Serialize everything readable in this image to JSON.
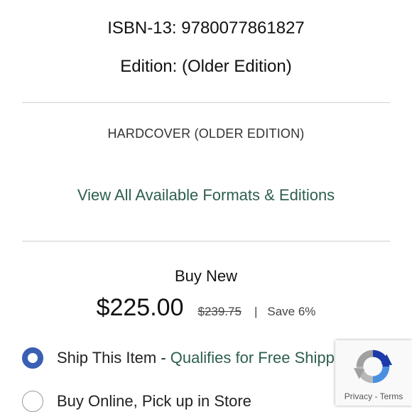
{
  "product": {
    "isbn_line": "ISBN-13: 9780077861827",
    "edition_line": "Edition: (Older Edition)",
    "format_label": "HARDCOVER (OLDER EDITION)",
    "formats_link": "View All Available Formats & Editions"
  },
  "pricing": {
    "heading": "Buy New",
    "price": "$225.00",
    "original_price": "$239.75",
    "separator": "|",
    "savings": "Save 6%"
  },
  "fulfillment": {
    "ship": {
      "label": "Ship This Item - ",
      "qualifier": "Qualifies for Free Shipping",
      "selected": true
    },
    "pickup": {
      "label": "Buy Online, Pick up in Store",
      "selected": false
    }
  },
  "recaptcha": {
    "privacy": "Privacy",
    "dash": "-",
    "terms": "Terms",
    "icon": "recaptcha-icon"
  },
  "colors": {
    "link_green": "#2e5f4d",
    "radio_blue": "#3a5fb3"
  }
}
